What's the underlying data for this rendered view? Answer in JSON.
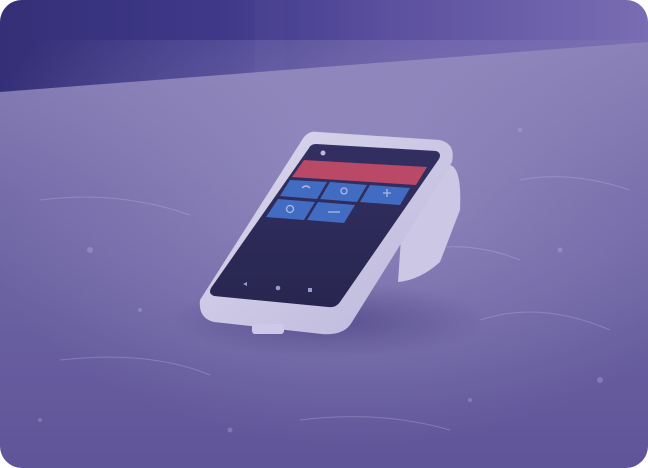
{
  "photo": {
    "subject": "handheld-payment-terminal-on-concrete-counter",
    "tint_color": "#6b5bb5",
    "screen": {
      "accent_color": "#c5465d",
      "tile_color": "#3d6fc4"
    }
  }
}
